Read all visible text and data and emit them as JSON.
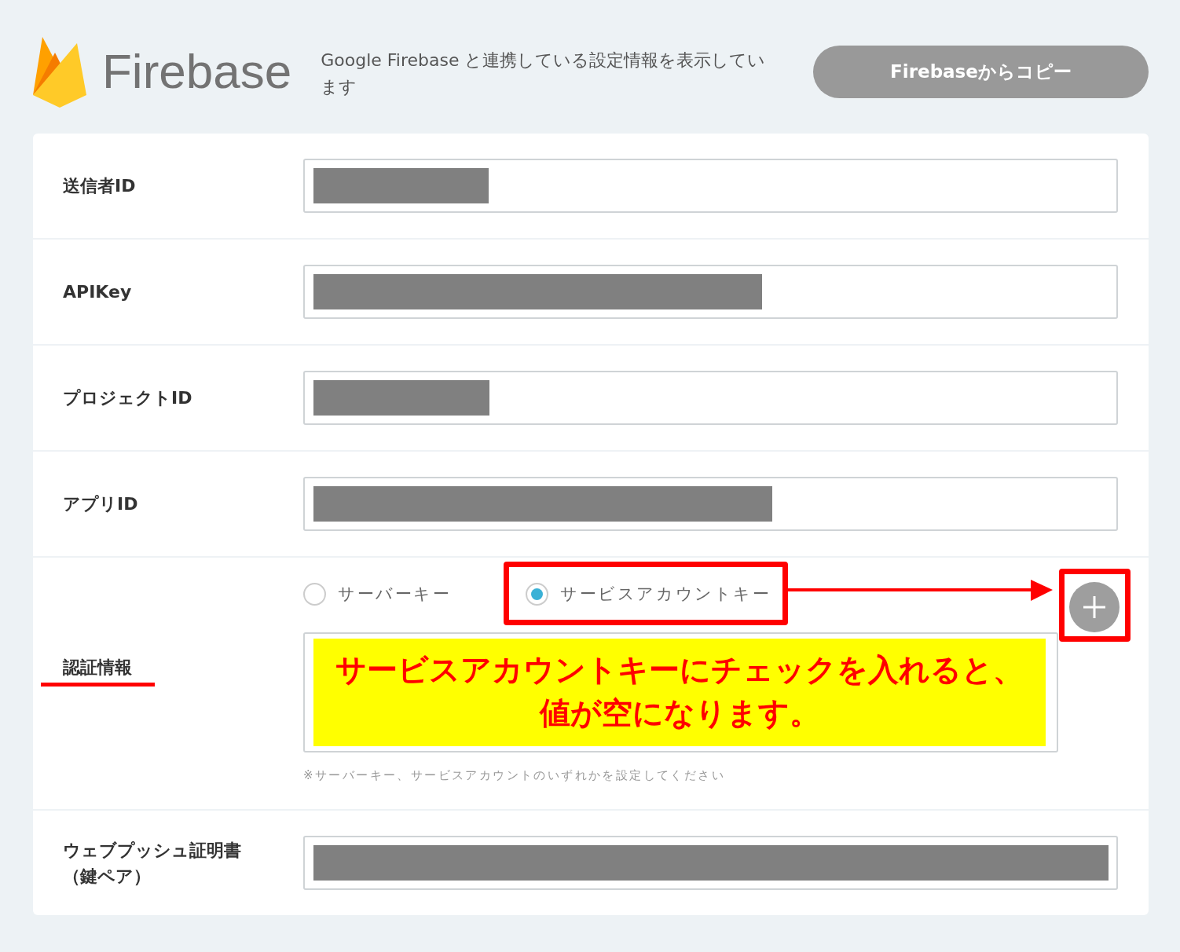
{
  "header": {
    "logo_text": "Firebase",
    "description": "Google Firebase と連携している設定情報を表示しています",
    "copy_button": "Firebaseからコピー"
  },
  "fields": [
    {
      "kind": "text",
      "label": "送信者ID",
      "redacted": true
    },
    {
      "kind": "text",
      "label": "APIKey",
      "redacted": true
    },
    {
      "kind": "text",
      "label": "プロジェクトID",
      "redacted": true
    },
    {
      "kind": "text",
      "label": "アプリID",
      "redacted": true
    },
    {
      "kind": "auth",
      "label": "認証情報",
      "options": [
        {
          "label": "サーバーキー",
          "selected": false
        },
        {
          "label": "サービスアカウントキー",
          "selected": true
        }
      ],
      "note": "※サーバーキー、サービスアカウントのいずれかを設定してください"
    },
    {
      "kind": "text",
      "label": "ウェブプッシュ証明書（鍵ペア）",
      "redacted": true
    }
  ],
  "annotation": {
    "callout": "サービスアカウントキーにチェックを入れると、値が空になります。"
  }
}
